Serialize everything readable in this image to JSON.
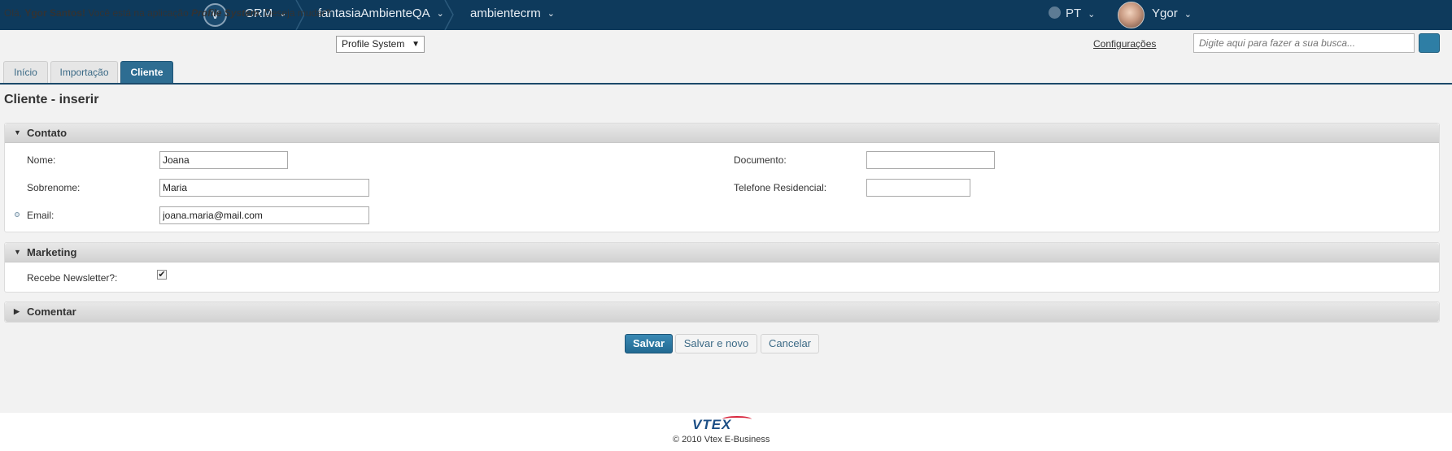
{
  "topbar": {
    "logo_letter": "V",
    "crumbs": [
      "CRM",
      "fantasiaAmbienteQA",
      "ambientecrm"
    ],
    "language": "PT",
    "user_name": "Ygor",
    "chevron": "⌄"
  },
  "greeting": {
    "prefix": "Olá, ",
    "user_full": "Ygor Santos!",
    "middle": " Você está na aplicação ",
    "app_name": "Profile System",
    "suffix": ". Deseja mudar?"
  },
  "app_selector": {
    "value": "Profile System",
    "arrow": "▼"
  },
  "config_link": "Configurações",
  "search": {
    "placeholder": "Digite aqui para fazer a sua busca..."
  },
  "tabs": [
    "Início",
    "Importação",
    "Cliente"
  ],
  "page_title": "Cliente - inserir",
  "sections": {
    "contato": {
      "title": "Contato",
      "fields": {
        "nome": {
          "label": "Nome:",
          "value": "Joana"
        },
        "sobrenome": {
          "label": "Sobrenome:",
          "value": "Maria"
        },
        "email": {
          "label": "Email:",
          "value": "joana.maria@mail.com"
        },
        "documento": {
          "label": "Documento:",
          "value": ""
        },
        "telefone": {
          "label": "Telefone Residencial:",
          "value": ""
        }
      }
    },
    "marketing": {
      "title": "Marketing",
      "newsletter": {
        "label": "Recebe Newsletter?:",
        "checked": true,
        "check_glyph": "✔"
      }
    },
    "comentar": {
      "title": "Comentar"
    }
  },
  "triangles": {
    "expanded": "▼",
    "collapsed": "▶"
  },
  "buttons": {
    "save": "Salvar",
    "save_new": "Salvar e novo",
    "cancel": "Cancelar"
  },
  "footer": {
    "logo_text": "VTEX",
    "copyright": "© 2010 Vtex E-Business"
  }
}
